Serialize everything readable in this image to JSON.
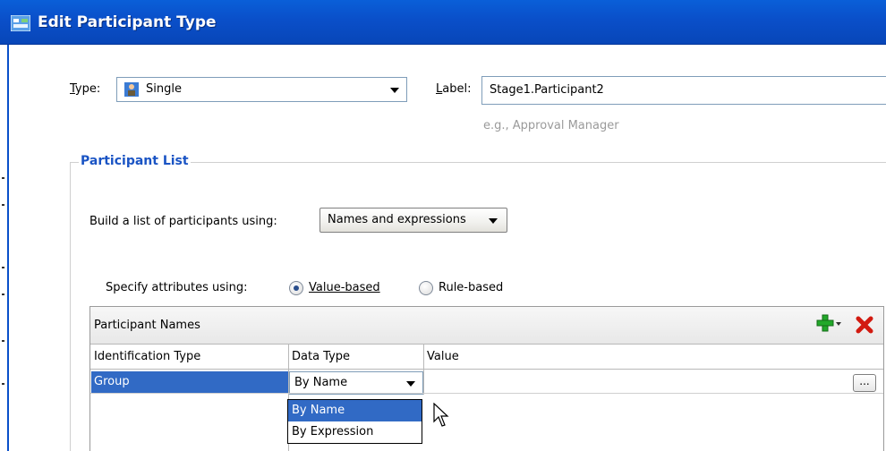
{
  "window": {
    "title": "Edit Participant Type"
  },
  "type_field": {
    "label": "Type:",
    "value": "Single"
  },
  "label_field": {
    "label": "Label:",
    "value": "Stage1.Participant2",
    "hint": "e.g., Approval Manager"
  },
  "participant_list": {
    "legend": "Participant List",
    "build_label": "Build a list of participants using:",
    "build_value": "Names and expressions",
    "specify_label": "Specify attributes using:",
    "radio_value_based": "Value-based",
    "radio_rule_based": "Rule-based",
    "radio_selected": "Value-based"
  },
  "grid": {
    "title": "Participant Names",
    "columns": [
      "Identification Type",
      "Data Type",
      "Value"
    ],
    "rows": [
      {
        "identification_type": "Group",
        "data_type": "By Name",
        "value": ""
      }
    ],
    "ellipsis": "..."
  },
  "data_type_dropdown": {
    "options": [
      "By Name",
      "By Expression"
    ],
    "selected": "By Name"
  },
  "icons": {
    "title": "window-app-icon",
    "type": "user-icon",
    "add": "add-plus-icon",
    "delete": "delete-x-icon"
  },
  "colors": {
    "titlebar": "#0a4fc9",
    "legend": "#1a54c4",
    "selection": "#316ac5"
  }
}
